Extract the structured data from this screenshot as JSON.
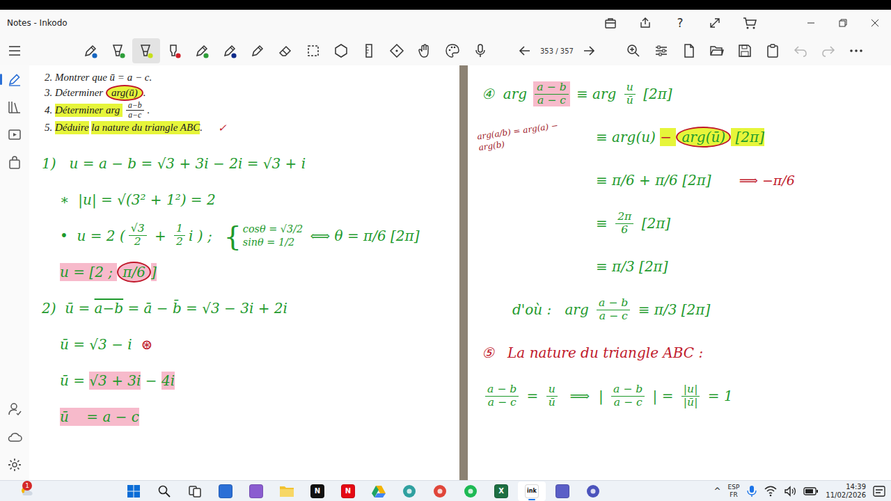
{
  "window": {
    "title": "Notes - Inkodo",
    "help": "?"
  },
  "toolbar": {
    "tools": [
      {
        "kind": "pen",
        "color": "#1565c0",
        "selected": false
      },
      {
        "kind": "highlighter",
        "color": "#2e9e3a",
        "selected": false
      },
      {
        "kind": "highlighter",
        "color": "#c6e01a",
        "selected": true
      },
      {
        "kind": "marker",
        "color": "#d0202a",
        "selected": false
      },
      {
        "kind": "pen",
        "color": "#2e9e3a",
        "selected": false
      },
      {
        "kind": "pen",
        "color": "#0d2a8a",
        "selected": false
      },
      {
        "kind": "pencil",
        "selected": false
      }
    ],
    "page": "353 / 357",
    "undo_disabled": true,
    "redo_disabled": true
  },
  "sidebar": {
    "top": [
      {
        "kind": "pen",
        "selected": true
      },
      {
        "kind": "library",
        "selected": false
      },
      {
        "kind": "slides",
        "selected": false
      },
      {
        "kind": "bag",
        "selected": false
      }
    ],
    "bottom": [
      {
        "kind": "person",
        "selected": false
      },
      {
        "kind": "cloud",
        "selected": false
      },
      {
        "kind": "gear",
        "selected": false
      }
    ]
  },
  "pages": [
    {
      "lines": [
        {
          "kind": "typed",
          "segs": [
            {
              "t": "2. Montrer que ū = a − c."
            }
          ]
        },
        {
          "kind": "typed",
          "segs": [
            {
              "t": "3. Déterminer "
            },
            {
              "t": "arg(ū)",
              "mark": "yellow",
              "circled": true
            },
            {
              "t": "."
            }
          ]
        },
        {
          "kind": "typed",
          "segs": [
            {
              "t": "4. "
            },
            {
              "t": "Déterminer arg ",
              "mark": "yellow"
            },
            {
              "num": "a−b",
              "den": "a−c"
            },
            {
              "t": "."
            }
          ]
        },
        {
          "kind": "typed",
          "segs": [
            {
              "t": "5. "
            },
            {
              "t": "Déduire",
              "mark": "yellow"
            },
            {
              "t": " "
            },
            {
              "t": "la nature du triangle ABC",
              "mark": "yellow"
            },
            {
              "t": ".      "
            },
            {
              "t": "✓",
              "color": "#c0182a"
            }
          ]
        },
        {
          "kind": "step",
          "segs": [
            {
              "t": "1)   u = a − b = √3 + 3i − 2i = √3 + i"
            }
          ]
        },
        {
          "kind": "bullet",
          "segs": [
            {
              "t": "∗  |u| = √(3² + 1²) = 2"
            }
          ]
        },
        {
          "kind": "bullet",
          "segs": [
            {
              "t": "•  u = 2 ("
            },
            {
              "num": "√3",
              "den": "2"
            },
            {
              "t": " + "
            },
            {
              "num": "1",
              "den": "2"
            },
            {
              "t": "i ) ;  "
            },
            {
              "brace": "{",
              "sys": [
                "cosθ = √3/2",
                "sinθ = 1/2"
              ]
            },
            {
              "t": " ⟺ θ = π/6 [2π]"
            }
          ]
        },
        {
          "kind": "bullet",
          "segs": [
            {
              "t": "u = [2 ; ",
              "mark": "pink"
            },
            {
              "t": "π/6",
              "mark": "pink",
              "circled": true
            },
            {
              "t": "]",
              "mark": "pink"
            }
          ]
        },
        {
          "kind": "step",
          "segs": [
            {
              "t": "2)  ū = "
            },
            {
              "t": "a−b",
              "over": true
            },
            {
              "t": " = ā − b̄ = √3 − 3i + 2i"
            }
          ]
        },
        {
          "kind": "bullet",
          "segs": [
            {
              "t": "ū = √3 − i  "
            },
            {
              "t": "⊛",
              "color": "#c0182a"
            }
          ]
        },
        {
          "kind": "bullet",
          "segs": [
            {
              "t": "ū = "
            },
            {
              "t": "√3 + 3i",
              "mark": "pink"
            },
            {
              "t": " − "
            },
            {
              "t": "4i",
              "mark": "pink"
            }
          ]
        },
        {
          "kind": "bullet",
          "segs": [
            {
              "t": "ū    = a − c",
              "mark": "pink"
            }
          ]
        }
      ]
    },
    {
      "lines": [
        {
          "kind": "step",
          "segs": [
            {
              "t": "④",
              "color": "#1e9a2c"
            },
            {
              "t": "  arg "
            },
            {
              "num": "a − b",
              "den": "a − c",
              "mark": "pink"
            },
            {
              "t": " ≡ arg "
            },
            {
              "num": "u",
              "den": "ū"
            },
            {
              "t": " [2π]"
            }
          ]
        },
        {
          "kind": "cont",
          "note": "arg(a/b) = arg(a) − arg(b)",
          "segs": [
            {
              "t": "≡ arg(u) "
            },
            {
              "t": "− ",
              "mark": "yellow",
              "color": "#c0182a"
            },
            {
              "t": "arg(ū)",
              "mark": "yellow",
              "circled": true
            },
            {
              "t": " [2π]",
              "mark": "yellow"
            }
          ]
        },
        {
          "kind": "cont",
          "aside": "⟹ −π/6",
          "segs": [
            {
              "t": "≡ π/6 + π/6 [2π]"
            }
          ]
        },
        {
          "kind": "cont",
          "segs": [
            {
              "t": "≡ "
            },
            {
              "num": "2π",
              "den": "6"
            },
            {
              "t": " [2π]"
            }
          ]
        },
        {
          "kind": "cont",
          "segs": [
            {
              "t": "≡ π/3 [2π]"
            }
          ]
        },
        {
          "kind": "mid",
          "segs": [
            {
              "t": "d'où :   arg "
            },
            {
              "num": "a − b",
              "den": "a − c"
            },
            {
              "t": " ≡ π/3 [2π]"
            }
          ]
        },
        {
          "kind": "step",
          "segs": [
            {
              "t": "⑤",
              "color": "#c0182a"
            },
            {
              "t": "   La nature du triangle ABC :",
              "color": "#c0182a"
            }
          ]
        },
        {
          "kind": "step",
          "segs": [
            {
              "num": "a − b",
              "den": "a − c"
            },
            {
              "t": " = "
            },
            {
              "num": "u",
              "den": "ū"
            },
            {
              "t": "  ⟹  | "
            },
            {
              "num": "a − b",
              "den": "a − c"
            },
            {
              "t": " | = "
            },
            {
              "num": "|u|",
              "den": "|ū|"
            },
            {
              "t": " = 1"
            }
          ]
        }
      ]
    }
  ],
  "taskbar": {
    "badge": "1",
    "apps": [
      {
        "kind": "start",
        "color": "#0a6cd6",
        "selected": false
      },
      {
        "kind": "search",
        "color": "#222222",
        "selected": false
      },
      {
        "kind": "taskview",
        "color": "#333333",
        "selected": false
      },
      {
        "kind": "square",
        "color": "#2b6fd6",
        "selected": false
      },
      {
        "kind": "square",
        "color": "#8a5cd0",
        "selected": false
      },
      {
        "kind": "folder",
        "color": "#f2c230",
        "selected": false
      },
      {
        "kind": "square",
        "color": "#111111",
        "glyph": "N",
        "selected": false
      },
      {
        "kind": "square",
        "color": "#e50914",
        "glyph": "N",
        "selected": false
      },
      {
        "kind": "triangle",
        "color": "#1fa463",
        "selected": false
      },
      {
        "kind": "circle",
        "color": "#2fa0a0",
        "selected": false
      },
      {
        "kind": "circle",
        "color": "#e0463a",
        "selected": false
      },
      {
        "kind": "circle",
        "color": "#1db954",
        "selected": false
      },
      {
        "kind": "square",
        "color": "#1d6f42",
        "glyph": "X",
        "selected": false
      },
      {
        "kind": "square",
        "color": "#ffffff",
        "glyph": "ink",
        "selected": true
      },
      {
        "kind": "square",
        "color": "#5b5fc7",
        "selected": false
      },
      {
        "kind": "circle",
        "color": "#4b53bc",
        "selected": false
      }
    ],
    "chevron": "^",
    "language": "ESP",
    "layout": "FR",
    "time": "14:39",
    "date": "11/02/2026"
  }
}
